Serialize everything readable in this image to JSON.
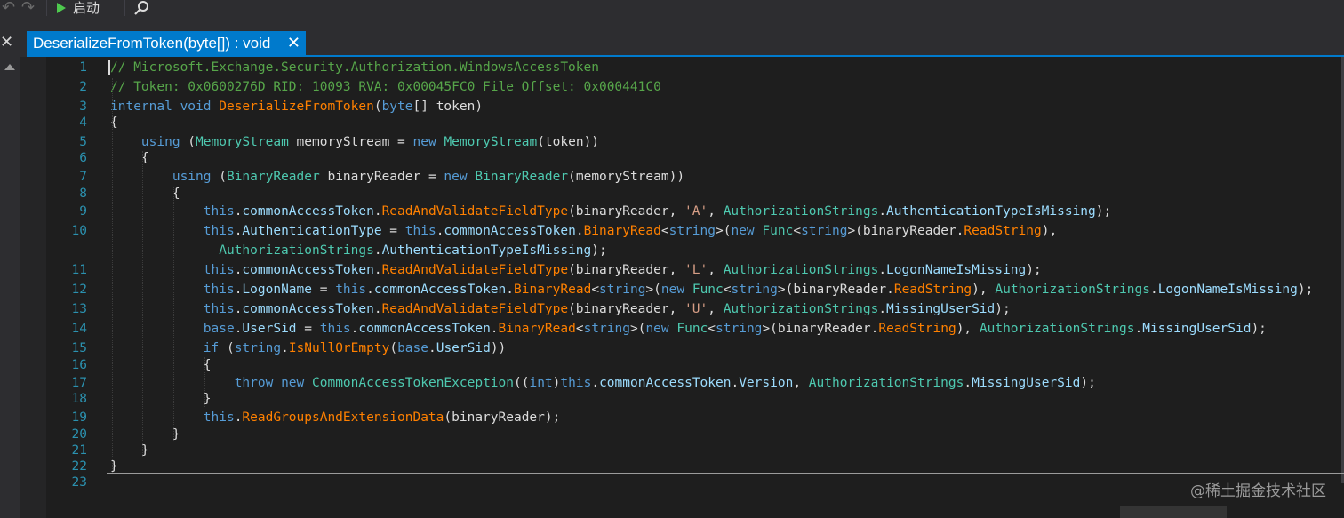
{
  "toolbar": {
    "start_label": "启动",
    "undo_icon": "undo-icon",
    "redo_icon": "redo-icon",
    "search_icon": "search-icon"
  },
  "tab": {
    "title": "DeserializeFromToken(byte[]) : void",
    "close": "✕"
  },
  "side_close": "✕",
  "colors": {
    "comment": "#57a64a",
    "keyword": "#569cd6",
    "type": "#4ec9b0",
    "method": "#ff8000",
    "property": "#9cdcfe",
    "string": "#d69d85",
    "text": "#dcdcdc",
    "line_number": "#2b91af",
    "accent": "#007acc"
  },
  "code_lines": [
    {
      "n": "1",
      "tokens": [
        [
          "c",
          "// Microsoft.Exchange.Security.Authorization.WindowsAccessToken"
        ]
      ]
    },
    {
      "n": "2",
      "tokens": [
        [
          "c",
          "// Token: 0x0600276D RID: 10093 RVA: 0x00045FC0 File Offset: 0x000441C0"
        ]
      ]
    },
    {
      "n": "3",
      "tokens": [
        [
          "k",
          "internal"
        ],
        [
          "p",
          " "
        ],
        [
          "k",
          "void"
        ],
        [
          "p",
          " "
        ],
        [
          "m",
          "DeserializeFromToken"
        ],
        [
          "p",
          "("
        ],
        [
          "k",
          "byte"
        ],
        [
          "p",
          "[] token)"
        ]
      ]
    },
    {
      "n": "4",
      "tokens": [
        [
          "p",
          "{"
        ]
      ]
    },
    {
      "n": "5",
      "tokens": [
        [
          "p",
          "    "
        ],
        [
          "k",
          "using"
        ],
        [
          "p",
          " ("
        ],
        [
          "t",
          "MemoryStream"
        ],
        [
          "p",
          " memoryStream = "
        ],
        [
          "k",
          "new"
        ],
        [
          "p",
          " "
        ],
        [
          "t",
          "MemoryStream"
        ],
        [
          "p",
          "(token))"
        ]
      ]
    },
    {
      "n": "6",
      "tokens": [
        [
          "p",
          "    {"
        ]
      ]
    },
    {
      "n": "7",
      "tokens": [
        [
          "p",
          "        "
        ],
        [
          "k",
          "using"
        ],
        [
          "p",
          " ("
        ],
        [
          "t",
          "BinaryReader"
        ],
        [
          "p",
          " binaryReader = "
        ],
        [
          "k",
          "new"
        ],
        [
          "p",
          " "
        ],
        [
          "t",
          "BinaryReader"
        ],
        [
          "p",
          "(memoryStream))"
        ]
      ]
    },
    {
      "n": "8",
      "tokens": [
        [
          "p",
          "        {"
        ]
      ]
    },
    {
      "n": "9",
      "tokens": [
        [
          "p",
          "            "
        ],
        [
          "k",
          "this"
        ],
        [
          "p",
          "."
        ],
        [
          "f",
          "commonAccessToken"
        ],
        [
          "p",
          "."
        ],
        [
          "m",
          "ReadAndValidateFieldType"
        ],
        [
          "p",
          "(binaryReader, "
        ],
        [
          "s",
          "'A'"
        ],
        [
          "p",
          ", "
        ],
        [
          "t",
          "AuthorizationStrings"
        ],
        [
          "p",
          "."
        ],
        [
          "f",
          "AuthenticationTypeIsMissing"
        ],
        [
          "p",
          ");"
        ]
      ]
    },
    {
      "n": "10",
      "tokens": [
        [
          "p",
          "            "
        ],
        [
          "k",
          "this"
        ],
        [
          "p",
          "."
        ],
        [
          "f",
          "AuthenticationType"
        ],
        [
          "p",
          " = "
        ],
        [
          "k",
          "this"
        ],
        [
          "p",
          "."
        ],
        [
          "f",
          "commonAccessToken"
        ],
        [
          "p",
          "."
        ],
        [
          "m",
          "BinaryRead"
        ],
        [
          "p",
          "<"
        ],
        [
          "k",
          "string"
        ],
        [
          "p",
          ">("
        ],
        [
          "k",
          "new"
        ],
        [
          "p",
          " "
        ],
        [
          "t",
          "Func"
        ],
        [
          "p",
          "<"
        ],
        [
          "k",
          "string"
        ],
        [
          "p",
          ">(binaryReader."
        ],
        [
          "m",
          "ReadString"
        ],
        [
          "p",
          "),"
        ]
      ]
    },
    {
      "n": "",
      "tokens": [
        [
          "p",
          "              "
        ],
        [
          "t",
          "AuthorizationStrings"
        ],
        [
          "p",
          "."
        ],
        [
          "f",
          "AuthenticationTypeIsMissing"
        ],
        [
          "p",
          ");"
        ]
      ]
    },
    {
      "n": "11",
      "tokens": [
        [
          "p",
          "            "
        ],
        [
          "k",
          "this"
        ],
        [
          "p",
          "."
        ],
        [
          "f",
          "commonAccessToken"
        ],
        [
          "p",
          "."
        ],
        [
          "m",
          "ReadAndValidateFieldType"
        ],
        [
          "p",
          "(binaryReader, "
        ],
        [
          "s",
          "'L'"
        ],
        [
          "p",
          ", "
        ],
        [
          "t",
          "AuthorizationStrings"
        ],
        [
          "p",
          "."
        ],
        [
          "f",
          "LogonNameIsMissing"
        ],
        [
          "p",
          ");"
        ]
      ]
    },
    {
      "n": "12",
      "tokens": [
        [
          "p",
          "            "
        ],
        [
          "k",
          "this"
        ],
        [
          "p",
          "."
        ],
        [
          "f",
          "LogonName"
        ],
        [
          "p",
          " = "
        ],
        [
          "k",
          "this"
        ],
        [
          "p",
          "."
        ],
        [
          "f",
          "commonAccessToken"
        ],
        [
          "p",
          "."
        ],
        [
          "m",
          "BinaryRead"
        ],
        [
          "p",
          "<"
        ],
        [
          "k",
          "string"
        ],
        [
          "p",
          ">("
        ],
        [
          "k",
          "new"
        ],
        [
          "p",
          " "
        ],
        [
          "t",
          "Func"
        ],
        [
          "p",
          "<"
        ],
        [
          "k",
          "string"
        ],
        [
          "p",
          ">(binaryReader."
        ],
        [
          "m",
          "ReadString"
        ],
        [
          "p",
          "), "
        ],
        [
          "t",
          "AuthorizationStrings"
        ],
        [
          "p",
          "."
        ],
        [
          "f",
          "LogonNameIsMissing"
        ],
        [
          "p",
          ");"
        ]
      ]
    },
    {
      "n": "13",
      "tokens": [
        [
          "p",
          "            "
        ],
        [
          "k",
          "this"
        ],
        [
          "p",
          "."
        ],
        [
          "f",
          "commonAccessToken"
        ],
        [
          "p",
          "."
        ],
        [
          "m",
          "ReadAndValidateFieldType"
        ],
        [
          "p",
          "(binaryReader, "
        ],
        [
          "s",
          "'U'"
        ],
        [
          "p",
          ", "
        ],
        [
          "t",
          "AuthorizationStrings"
        ],
        [
          "p",
          "."
        ],
        [
          "f",
          "MissingUserSid"
        ],
        [
          "p",
          ");"
        ]
      ]
    },
    {
      "n": "14",
      "tokens": [
        [
          "p",
          "            "
        ],
        [
          "k",
          "base"
        ],
        [
          "p",
          "."
        ],
        [
          "f",
          "UserSid"
        ],
        [
          "p",
          " = "
        ],
        [
          "k",
          "this"
        ],
        [
          "p",
          "."
        ],
        [
          "f",
          "commonAccessToken"
        ],
        [
          "p",
          "."
        ],
        [
          "m",
          "BinaryRead"
        ],
        [
          "p",
          "<"
        ],
        [
          "k",
          "string"
        ],
        [
          "p",
          ">("
        ],
        [
          "k",
          "new"
        ],
        [
          "p",
          " "
        ],
        [
          "t",
          "Func"
        ],
        [
          "p",
          "<"
        ],
        [
          "k",
          "string"
        ],
        [
          "p",
          ">(binaryReader."
        ],
        [
          "m",
          "ReadString"
        ],
        [
          "p",
          "), "
        ],
        [
          "t",
          "AuthorizationStrings"
        ],
        [
          "p",
          "."
        ],
        [
          "f",
          "MissingUserSid"
        ],
        [
          "p",
          ");"
        ]
      ]
    },
    {
      "n": "15",
      "tokens": [
        [
          "p",
          "            "
        ],
        [
          "k",
          "if"
        ],
        [
          "p",
          " ("
        ],
        [
          "k",
          "string"
        ],
        [
          "p",
          "."
        ],
        [
          "m",
          "IsNullOrEmpty"
        ],
        [
          "p",
          "("
        ],
        [
          "k",
          "base"
        ],
        [
          "p",
          "."
        ],
        [
          "f",
          "UserSid"
        ],
        [
          "p",
          "))"
        ]
      ]
    },
    {
      "n": "16",
      "tokens": [
        [
          "p",
          "            {"
        ]
      ]
    },
    {
      "n": "17",
      "tokens": [
        [
          "p",
          "                "
        ],
        [
          "k",
          "throw"
        ],
        [
          "p",
          " "
        ],
        [
          "k",
          "new"
        ],
        [
          "p",
          " "
        ],
        [
          "t",
          "CommonAccessTokenException"
        ],
        [
          "p",
          "(("
        ],
        [
          "k",
          "int"
        ],
        [
          "p",
          ")"
        ],
        [
          "k",
          "this"
        ],
        [
          "p",
          "."
        ],
        [
          "f",
          "commonAccessToken"
        ],
        [
          "p",
          "."
        ],
        [
          "f",
          "Version"
        ],
        [
          "p",
          ", "
        ],
        [
          "t",
          "AuthorizationStrings"
        ],
        [
          "p",
          "."
        ],
        [
          "f",
          "MissingUserSid"
        ],
        [
          "p",
          ");"
        ]
      ]
    },
    {
      "n": "18",
      "tokens": [
        [
          "p",
          "            }"
        ]
      ]
    },
    {
      "n": "19",
      "tokens": [
        [
          "p",
          "            "
        ],
        [
          "k",
          "this"
        ],
        [
          "p",
          "."
        ],
        [
          "m",
          "ReadGroupsAndExtensionData"
        ],
        [
          "p",
          "(binaryReader);"
        ]
      ]
    },
    {
      "n": "20",
      "tokens": [
        [
          "p",
          "        }"
        ]
      ]
    },
    {
      "n": "21",
      "tokens": [
        [
          "p",
          "    }"
        ]
      ]
    },
    {
      "n": "22",
      "tokens": [
        [
          "p",
          "}"
        ]
      ]
    },
    {
      "n": "23",
      "tokens": [
        [
          "p",
          ""
        ]
      ]
    }
  ],
  "watermark": "@稀土掘金技术社区"
}
